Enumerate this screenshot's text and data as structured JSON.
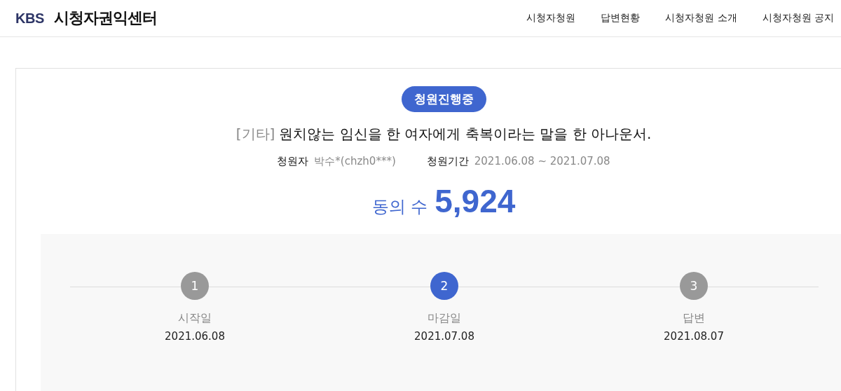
{
  "header": {
    "logo": "KBS",
    "title": "시청자권익센터",
    "nav": [
      {
        "label": "시청자청원"
      },
      {
        "label": "답변현황"
      },
      {
        "label": "시청자청원 소개"
      },
      {
        "label": "시청자청원 공지"
      }
    ]
  },
  "petition": {
    "status": "청원진행중",
    "category": "[기타]",
    "title": "원치않는 임신을 한 여자에게 축복이라는 말을 한 아나운서.",
    "meta": [
      {
        "label": "청원자",
        "value": "박수*(chzh0***)"
      },
      {
        "label": "청원기간",
        "value": "2021.06.08 ~ 2021.07.08"
      }
    ],
    "agree_label": "동의 수",
    "agree_count": "5,924",
    "steps": [
      {
        "number": "1",
        "label": "시작일",
        "date": "2021.06.08",
        "selected": false
      },
      {
        "number": "2",
        "label": "마감일",
        "date": "2021.07.08",
        "selected": true
      },
      {
        "number": "3",
        "label": "답변",
        "date": "2021.08.07",
        "selected": false
      }
    ]
  }
}
